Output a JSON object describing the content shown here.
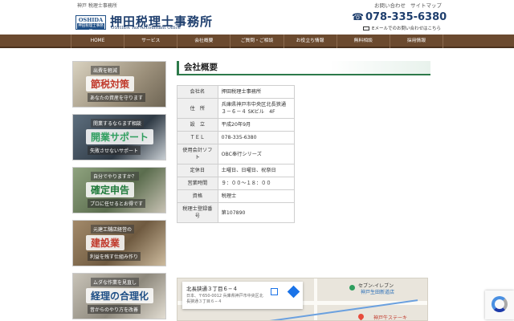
{
  "header": {
    "tagline": "神戸 税理士事務所",
    "top_links": [
      "お問い合わせ",
      "サイトマップ"
    ],
    "logo_en": "OSHIDA",
    "logo_ja": "押田税理士事務所",
    "title": "押田税理士事務所",
    "subtitle": "OSHIDA Tax Accountant Office",
    "phone": "078-335-6380",
    "mail_text": "Eメールでのお問い合わせはこちら"
  },
  "nav": [
    "HOME",
    "サービス",
    "会社概要",
    "ご質問・ご相談",
    "お役立ち情報",
    "無料相談",
    "採用情報"
  ],
  "sidebar": [
    {
      "top": "出費を軽減",
      "main": "節税対策",
      "bottom": "あなたの資産を守ります",
      "color": "#c0392b"
    },
    {
      "top": "開業するならまず相談",
      "main": "開業サポート",
      "bottom": "失敗させないサポート",
      "color": "#2e9e5e"
    },
    {
      "top": "自分でやりますか？",
      "main": "確定申告",
      "bottom": "プロに任せるとお得です",
      "color": "#1f7a3a"
    },
    {
      "top": "元建工舗店経営の",
      "main": "建設業",
      "bottom": "利益を残す仕組み作り",
      "color": "#c0392b"
    },
    {
      "top": "ムダな作業を見直し",
      "main": "経理の合理化",
      "bottom": "昔からのやり方を改善",
      "color": "#1f4f86"
    }
  ],
  "main": {
    "section_title": "会社概要",
    "profile": [
      {
        "label": "会社名",
        "value": "押田税理士事務所"
      },
      {
        "label": "住　所",
        "value": "兵庫県神戸市中央区北長狭通３－６－４ SKビル　4F"
      },
      {
        "label": "設　立",
        "value": "平成20年9月"
      },
      {
        "label": "ＴＥＬ",
        "value": "078-335-6380"
      },
      {
        "label": "使用会計ソフト",
        "value": "OBC奉行シリーズ"
      },
      {
        "label": "定休日",
        "value": "土曜日、日曜日、祝祭日"
      },
      {
        "label": "営業時間",
        "value": "９：００～１８：００"
      },
      {
        "label": "資格",
        "value": "税理士"
      },
      {
        "label": "税理士登録番号",
        "value": "第107890"
      }
    ]
  },
  "map": {
    "place_name": "北長狭通３丁目６−４",
    "place_address": "日本、〒650-0012 兵庫県神戸市中央区北長狭通３丁目６−４",
    "label_seven": "セブン-イレブン",
    "label_station": "神戸生田新道店",
    "label_steak": "神戸牛ステーキ"
  }
}
